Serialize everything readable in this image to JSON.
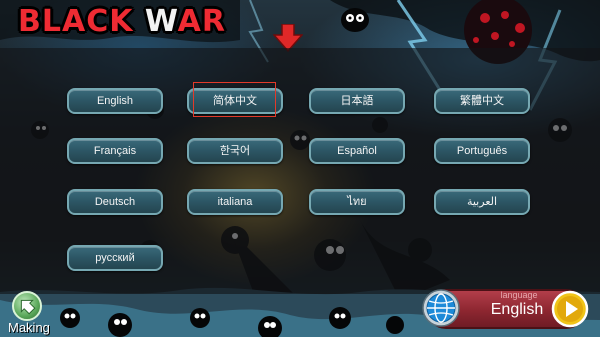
{
  "header": {
    "title_part1": "BLACK ",
    "title_part2": "W",
    "title_part3": "AR"
  },
  "languages": [
    "English",
    "简体中文",
    "日本語",
    "繁體中文",
    "Français",
    "한국어",
    "Español",
    "Português",
    "Deutsch",
    "italiana",
    "ไทย",
    "العربية",
    "русский"
  ],
  "highlighted_language": "简体中文",
  "footer": {
    "making_label": "Making",
    "language_caption": "language",
    "current_language": "English"
  },
  "colors": {
    "title_red": "#ee2b33",
    "button_teal": "#2d5766",
    "button_border": "#76a8b2",
    "highlight_box": "#e23a2a",
    "language_plate": "#8d2630",
    "play_yellow": "#f0c419"
  },
  "icons": [
    "down-arrow-icon",
    "back-arrow-icon",
    "globe-icon",
    "play-icon"
  ]
}
